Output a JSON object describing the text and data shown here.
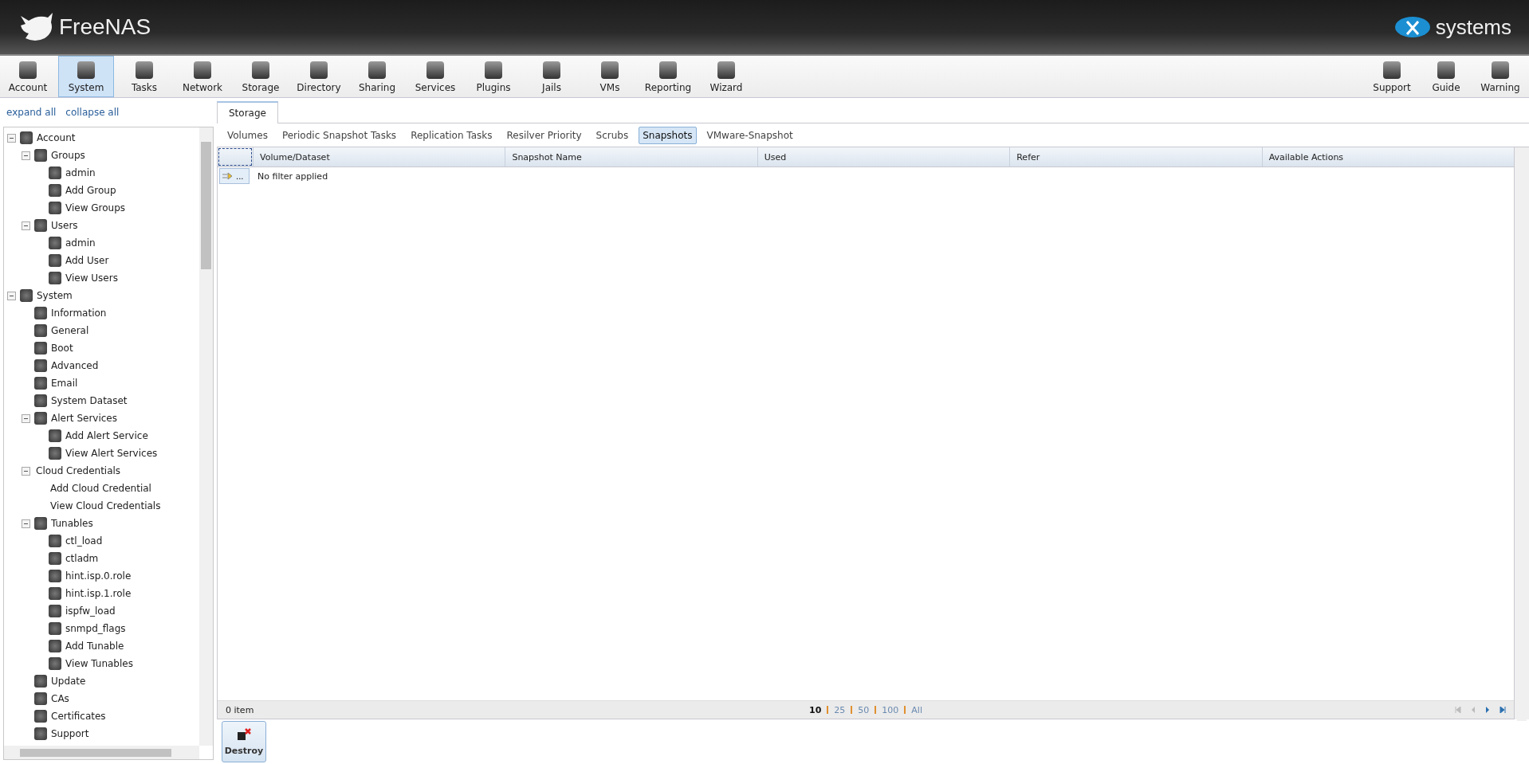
{
  "header": {
    "logo_text": "FreeNAS",
    "vendor_text": "systems"
  },
  "toolbar": {
    "items": [
      {
        "label": "Account",
        "selected": false
      },
      {
        "label": "System",
        "selected": true
      },
      {
        "label": "Tasks",
        "selected": false
      },
      {
        "label": "Network",
        "selected": false
      },
      {
        "label": "Storage",
        "selected": false
      },
      {
        "label": "Directory",
        "selected": false
      },
      {
        "label": "Sharing",
        "selected": false
      },
      {
        "label": "Services",
        "selected": false
      },
      {
        "label": "Plugins",
        "selected": false
      },
      {
        "label": "Jails",
        "selected": false
      },
      {
        "label": "VMs",
        "selected": false
      },
      {
        "label": "Reporting",
        "selected": false
      },
      {
        "label": "Wizard",
        "selected": false
      }
    ],
    "right_items": [
      {
        "label": "Support"
      },
      {
        "label": "Guide"
      },
      {
        "label": "Warning"
      }
    ]
  },
  "sidebar": {
    "links": [
      "expand all",
      "collapse all"
    ],
    "tree": [
      {
        "label": "Account",
        "expanded": true,
        "children": [
          {
            "label": "Groups",
            "expanded": true,
            "children": [
              {
                "label": "admin"
              },
              {
                "label": "Add Group"
              },
              {
                "label": "View Groups"
              }
            ]
          },
          {
            "label": "Users",
            "expanded": true,
            "children": [
              {
                "label": "admin"
              },
              {
                "label": "Add User"
              },
              {
                "label": "View Users"
              }
            ]
          }
        ]
      },
      {
        "label": "System",
        "expanded": true,
        "children": [
          {
            "label": "Information"
          },
          {
            "label": "General"
          },
          {
            "label": "Boot"
          },
          {
            "label": "Advanced"
          },
          {
            "label": "Email"
          },
          {
            "label": "System Dataset"
          },
          {
            "label": "Alert Services",
            "expanded": true,
            "children": [
              {
                "label": "Add Alert Service"
              },
              {
                "label": "View Alert Services"
              }
            ]
          },
          {
            "label": "Cloud Credentials",
            "expanded": true,
            "icon": false,
            "children": [
              {
                "label": "Add Cloud Credential",
                "icon": false
              },
              {
                "label": "View Cloud Credentials",
                "icon": false
              }
            ]
          },
          {
            "label": "Tunables",
            "expanded": true,
            "children": [
              {
                "label": "ctl_load"
              },
              {
                "label": "ctladm"
              },
              {
                "label": "hint.isp.0.role"
              },
              {
                "label": "hint.isp.1.role"
              },
              {
                "label": "ispfw_load"
              },
              {
                "label": "snmpd_flags"
              },
              {
                "label": "Add Tunable"
              },
              {
                "label": "View Tunables"
              }
            ]
          },
          {
            "label": "Update"
          },
          {
            "label": "CAs"
          },
          {
            "label": "Certificates"
          },
          {
            "label": "Support"
          }
        ]
      }
    ]
  },
  "tabs": [
    {
      "label": "Storage",
      "selected": true
    }
  ],
  "subtabs": [
    {
      "label": "Volumes",
      "selected": false
    },
    {
      "label": "Periodic Snapshot Tasks",
      "selected": false
    },
    {
      "label": "Replication Tasks",
      "selected": false
    },
    {
      "label": "Resilver Priority",
      "selected": false
    },
    {
      "label": "Scrubs",
      "selected": false
    },
    {
      "label": "Snapshots",
      "selected": true
    },
    {
      "label": "VMware-Snapshot",
      "selected": false
    }
  ],
  "table": {
    "columns": [
      "Volume/Dataset",
      "Snapshot Name",
      "Used",
      "Refer",
      "Available Actions"
    ],
    "filter_button": "...",
    "filter_text": "No filter applied"
  },
  "footer": {
    "count": "0 item",
    "page_sizes": [
      {
        "label": "10",
        "selected": true
      },
      {
        "label": "25",
        "selected": false
      },
      {
        "label": "50",
        "selected": false
      },
      {
        "label": "100",
        "selected": false
      },
      {
        "label": "All",
        "selected": false
      }
    ]
  },
  "actions": [
    "Destroy"
  ]
}
